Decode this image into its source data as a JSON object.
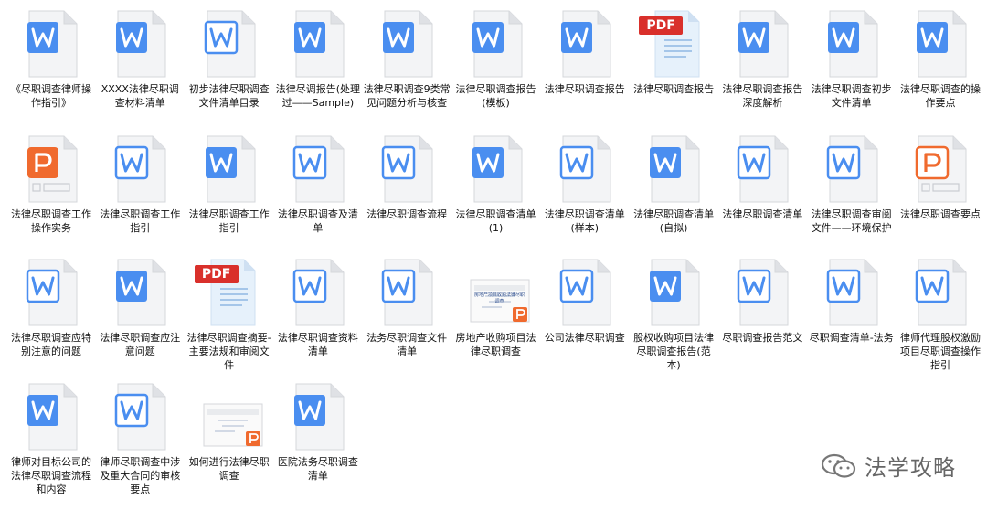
{
  "files": [
    {
      "label": "《尽职调查律师操作指引》",
      "icon": "wps-writer-icon"
    },
    {
      "label": "XXXX法律尽职调查材料清单",
      "icon": "wps-writer-icon"
    },
    {
      "label": "初步法律尽职调查文件清单目录",
      "icon": "wps-writer-outline-icon"
    },
    {
      "label": "法律尽调报告(处理过——Sample)",
      "icon": "wps-writer-icon"
    },
    {
      "label": "法律尽职调查9类常见问题分析与核查",
      "icon": "wps-writer-icon"
    },
    {
      "label": "法律尽职调查报告(模板)",
      "icon": "wps-writer-icon"
    },
    {
      "label": "法律尽职调查报告",
      "icon": "wps-writer-icon"
    },
    {
      "label": "法律尽职调查报告",
      "icon": "pdf-icon",
      "badge": "PDF"
    },
    {
      "label": "法律尽职调查报告深度解析",
      "icon": "wps-writer-icon"
    },
    {
      "label": "法律尽职调查初步文件清单",
      "icon": "wps-writer-icon"
    },
    {
      "label": "法律尽职调查的操作要点",
      "icon": "wps-writer-icon"
    },
    {
      "label": "法律尽职调查工作操作实务",
      "icon": "wps-presentation-icon"
    },
    {
      "label": "法律尽职调查工作指引",
      "icon": "wps-writer-outline-icon"
    },
    {
      "label": "法律尽职调查工作指引",
      "icon": "wps-writer-icon"
    },
    {
      "label": "法律尽职调查及清单",
      "icon": "wps-writer-outline-icon"
    },
    {
      "label": "法律尽职调查流程",
      "icon": "wps-writer-outline-icon"
    },
    {
      "label": "法律尽职调查清单(1)",
      "icon": "wps-writer-icon"
    },
    {
      "label": "法律尽职调查清单(样本)",
      "icon": "wps-writer-outline-icon"
    },
    {
      "label": "法律尽职调查清单(自拟)",
      "icon": "wps-writer-icon"
    },
    {
      "label": "法律尽职调查清单",
      "icon": "wps-writer-outline-icon"
    },
    {
      "label": "法律尽职调查审阅文件——环境保护",
      "icon": "wps-writer-outline-icon"
    },
    {
      "label": "法律尽职调查要点",
      "icon": "wps-presentation-outline-icon"
    },
    {
      "label": "法律尽职调查应特别注意的问题",
      "icon": "wps-writer-outline-icon"
    },
    {
      "label": "法律尽职调查应注意问题",
      "icon": "wps-writer-icon"
    },
    {
      "label": "法律尽职调查摘要-主要法规和审阅文件",
      "icon": "pdf-icon",
      "badge": "PDF"
    },
    {
      "label": "法律尽职调查资料清单",
      "icon": "wps-writer-outline-icon"
    },
    {
      "label": "法务尽职调查文件清单",
      "icon": "wps-writer-outline-icon"
    },
    {
      "label": "房地产收购项目法律尽职调查",
      "icon": "ppt-thumbnail-icon",
      "thumb_title": "房地产项目收购法律尽职调查"
    },
    {
      "label": "公司法律尽职调查",
      "icon": "wps-writer-outline-icon"
    },
    {
      "label": "股权收购项目法律尽职调查报告(范本)",
      "icon": "wps-writer-icon"
    },
    {
      "label": "尽职调查报告范文",
      "icon": "wps-writer-outline-icon"
    },
    {
      "label": "尽职调查清单-法务",
      "icon": "wps-writer-outline-icon"
    },
    {
      "label": "律师代理股权激励项目尽职调查操作指引",
      "icon": "wps-writer-outline-icon"
    },
    {
      "label": "律师对目标公司的法律尽职调查流程和内容",
      "icon": "wps-writer-icon"
    },
    {
      "label": "律师尽职调查中涉及重大合同的审核要点",
      "icon": "wps-writer-outline-icon"
    },
    {
      "label": "如何进行法律尽职调查",
      "icon": "ppt-thumbnail-icon",
      "thumb_title": ""
    },
    {
      "label": "医院法务尽职调查清单",
      "icon": "wps-writer-icon"
    }
  ],
  "watermark": {
    "text": "法学攻略",
    "icon": "wechat-icon"
  },
  "colors": {
    "writer": "#4a8ef0",
    "presentation": "#f06a2e",
    "pdf": "#d9302b",
    "page": "#f3f4f6",
    "fold": "#dfe1e5"
  }
}
